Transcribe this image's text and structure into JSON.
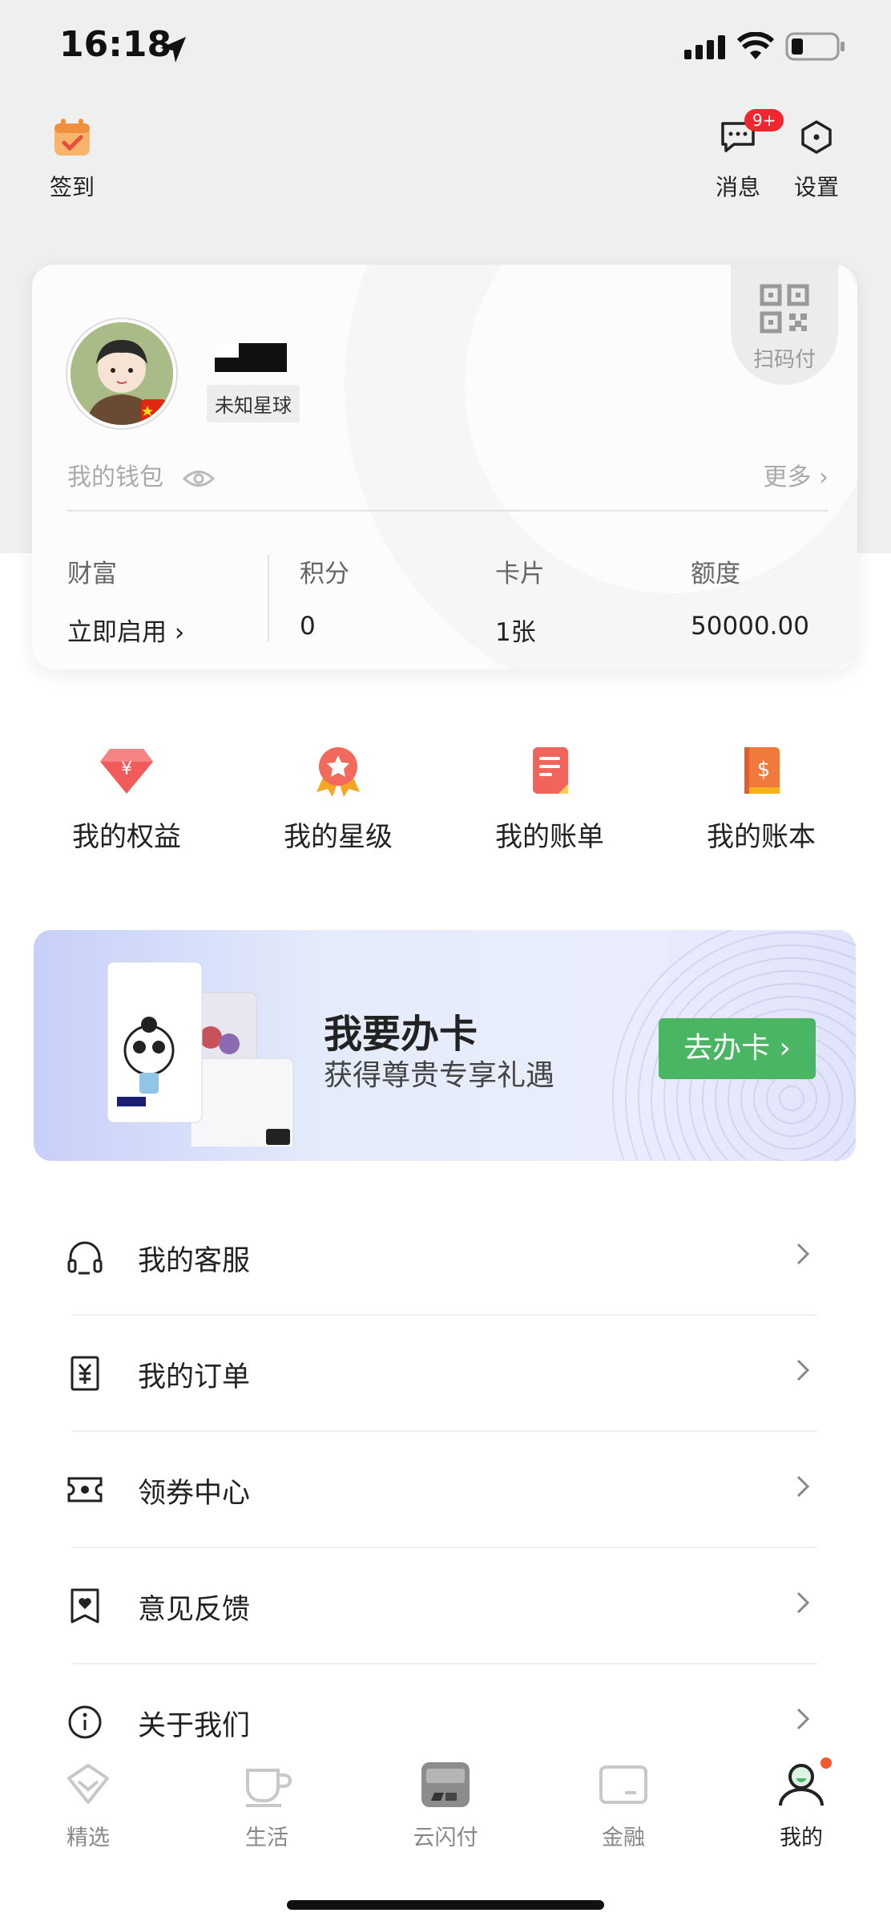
{
  "status_bar": {
    "time": "16:18"
  },
  "header": {
    "checkin_label": "签到",
    "messages_label": "消息",
    "messages_badge": "9+",
    "settings_label": "设置"
  },
  "profile": {
    "tag": "未知星球",
    "qr_label": "扫码付",
    "wallet_label": "我的钱包",
    "more_label": "更多 ›",
    "stats": [
      {
        "label": "财富",
        "value": "立即启用 ›"
      },
      {
        "label": "积分",
        "value": "0"
      },
      {
        "label": "卡片",
        "value": "1张"
      },
      {
        "label": "额度",
        "value": "50000.00"
      }
    ]
  },
  "quick_entries": [
    {
      "label": "我的权益",
      "icon": "gem-icon",
      "color": "#f15b5b"
    },
    {
      "label": "我的星级",
      "icon": "star-medal-icon",
      "color": "#f16a5b"
    },
    {
      "label": "我的账单",
      "icon": "bill-icon",
      "color": "#f0645b"
    },
    {
      "label": "我的账本",
      "icon": "ledger-icon",
      "color": "#f07a3c"
    }
  ],
  "banner": {
    "title": "我要办卡",
    "subtitle": "获得尊贵专享礼遇",
    "button": "去办卡 ›",
    "button_color": "#4ab562"
  },
  "menu": [
    {
      "label": "我的客服",
      "icon": "headset-icon"
    },
    {
      "label": "我的订单",
      "icon": "order-icon"
    },
    {
      "label": "领券中心",
      "icon": "coupon-icon"
    },
    {
      "label": "意见反馈",
      "icon": "feedback-icon"
    },
    {
      "label": "关于我们",
      "icon": "info-icon"
    }
  ],
  "tabs": [
    {
      "label": "精选",
      "icon": "featured-icon",
      "active": false
    },
    {
      "label": "生活",
      "icon": "cup-icon",
      "active": false
    },
    {
      "label": "云闪付",
      "icon": "cloud-quickpass-icon",
      "active": false
    },
    {
      "label": "金融",
      "icon": "finance-icon",
      "active": false
    },
    {
      "label": "我的",
      "icon": "profile-icon",
      "active": true
    }
  ]
}
